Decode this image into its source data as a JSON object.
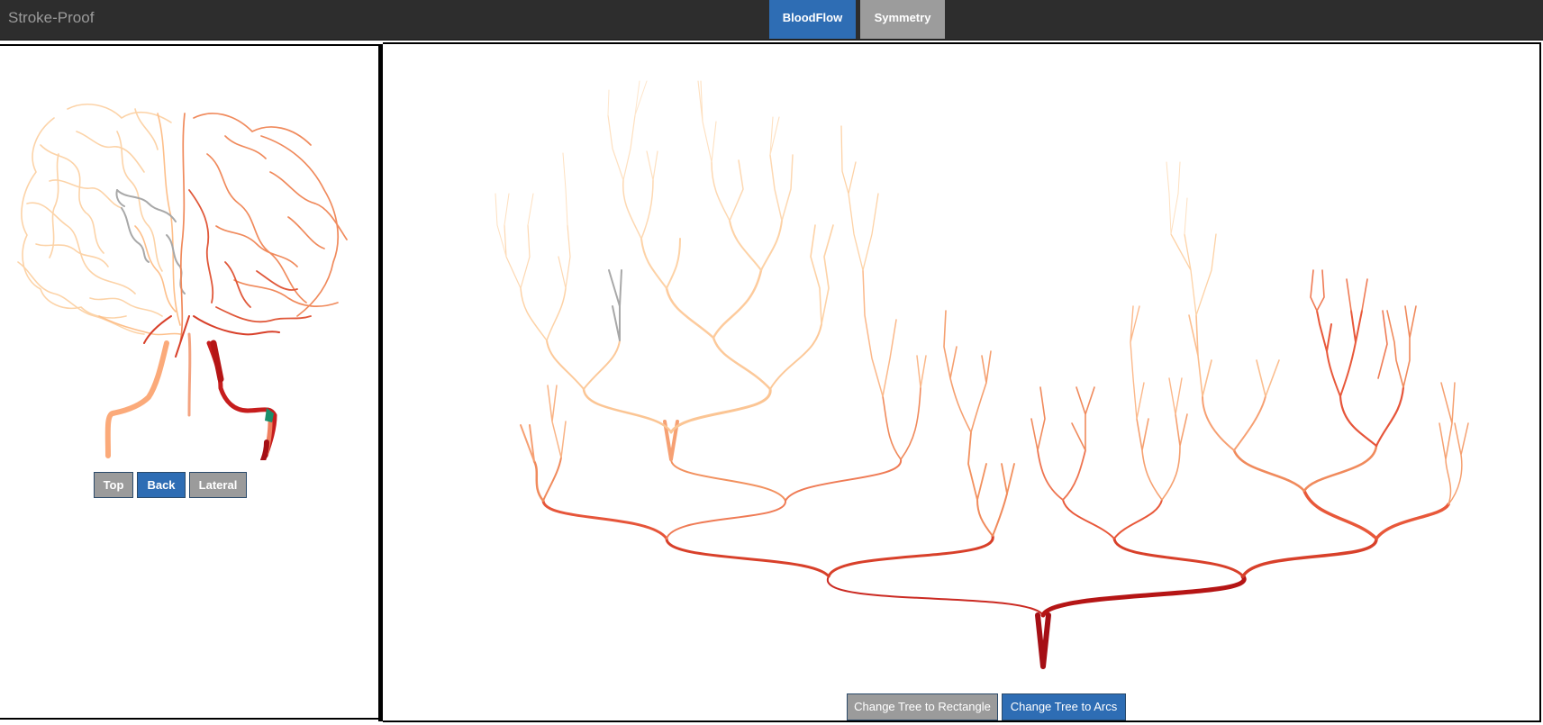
{
  "app": {
    "title": "Stroke-Proof"
  },
  "tabs": [
    {
      "label": "BloodFlow",
      "active": true
    },
    {
      "label": "Symmetry",
      "active": false
    }
  ],
  "brain_view": {
    "buttons": [
      {
        "label": "Top",
        "active": false
      },
      {
        "label": "Back",
        "active": true
      },
      {
        "label": "Lateral",
        "active": false
      }
    ]
  },
  "tree_view": {
    "buttons": [
      {
        "label": "Change Tree to Rectangle",
        "active": false
      },
      {
        "label": "Change Tree to Arcs",
        "active": true
      }
    ]
  },
  "colors": {
    "accent_blue": "#2e6db4",
    "inactive_gray": "#9b9b9b",
    "topbar": "#2d2d2d",
    "flow_high": "#a50f15",
    "flow_mid": "#ef6548",
    "flow_low": "#fdd0a2",
    "no_flow": "#9e9e9e",
    "marker_green": "#1a8f6b"
  }
}
